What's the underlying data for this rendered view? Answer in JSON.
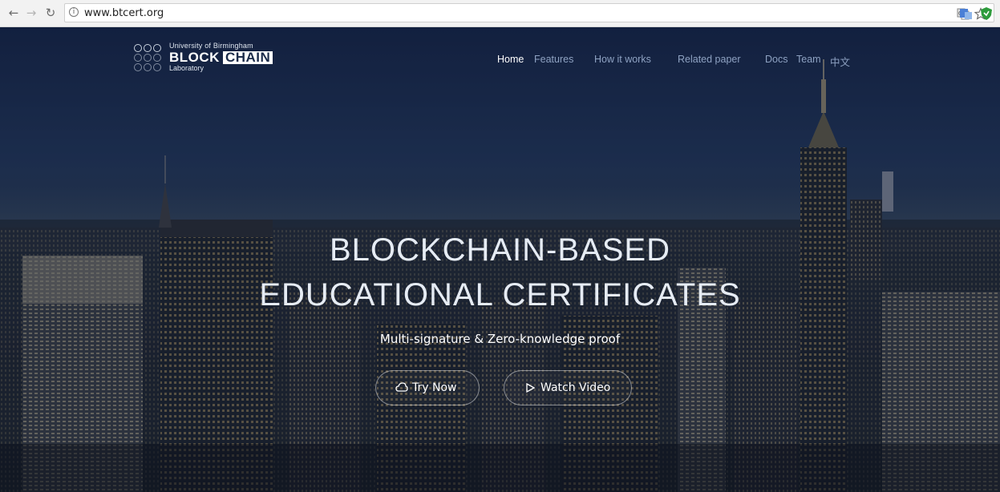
{
  "browser": {
    "url": "www.btcert.org",
    "back_icon": "back-arrow-icon",
    "forward_icon": "forward-arrow-icon",
    "reload_icon": "reload-icon",
    "info_icon": "info-icon",
    "extensions": [
      "translate-icon",
      "bookmark-star-icon",
      "extension-icon",
      "shield-extension-icon"
    ]
  },
  "logo": {
    "line1": "University of Birmingham",
    "word1": "BLOCK",
    "word2": "CHAIN",
    "line3": "Laboratory"
  },
  "nav": {
    "items": [
      "Home",
      "Features",
      "How it works",
      "Related paper",
      "Docs",
      "Team",
      "中文"
    ],
    "active": "Home"
  },
  "hero": {
    "title_line1": "BLOCKCHAIN-BASED",
    "title_line2": "EDUCATIONAL CERTIFICATES",
    "subtitle": "Multi-signature & Zero-knowledge proof",
    "try_button": "Try Now",
    "watch_button": "Watch Video"
  },
  "colors": {
    "hero_text": "#e6ecf4",
    "nav_active": "#ffffff",
    "nav_inactive": "#8ea2c2",
    "sky_top": "#16264a"
  }
}
